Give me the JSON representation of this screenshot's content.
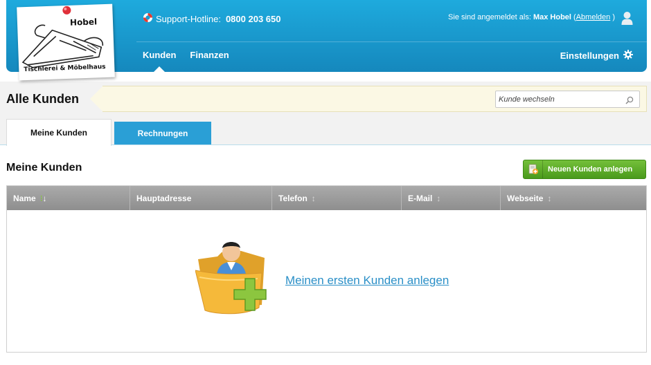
{
  "logo": {
    "name": "Hobel",
    "subtitle": "Tischlerei & Möbelhaus"
  },
  "header": {
    "support_label": "Support-Hotline:",
    "support_number": "0800 203 650",
    "login_prefix": "Sie sind angemeldet als:",
    "user_name": "Max Hobel",
    "paren_open": "(",
    "logout_label": "Abmelden",
    "paren_close": ")",
    "nav": [
      {
        "label": "Kunden",
        "active": true
      },
      {
        "label": "Finanzen",
        "active": false
      }
    ],
    "settings_label": "Einstellungen"
  },
  "page": {
    "title": "Alle Kunden",
    "search_placeholder": "Kunde wechseln"
  },
  "tabs": [
    {
      "label": "Meine Kunden",
      "active": true
    },
    {
      "label": "Rechnungen",
      "active": false
    }
  ],
  "section": {
    "title": "Meine Kunden",
    "new_button_label": "Neuen Kunden anlegen"
  },
  "table": {
    "columns": [
      {
        "label": "Name",
        "sorted": true
      },
      {
        "label": "Hauptadresse",
        "sorted": false
      },
      {
        "label": "Telefon",
        "sorted": false
      },
      {
        "label": "E-Mail",
        "sorted": false
      },
      {
        "label": "Webseite",
        "sorted": false
      }
    ],
    "rows": [],
    "empty_link": "Meinen ersten Kunden anlegen"
  },
  "icons": {
    "support": "lifebuoy-icon",
    "user": "user-icon",
    "settings": "gear-icon",
    "search": "search-icon",
    "new_customer": "add-contact-icon",
    "empty_state": "folder-person-add-icon"
  },
  "colors": {
    "header": "#1a9bd2",
    "tab_inactive": "#2a9fd6",
    "button_green": "#5aa82a",
    "link": "#2a8fc7",
    "notice_bg": "#fbf8e4"
  }
}
